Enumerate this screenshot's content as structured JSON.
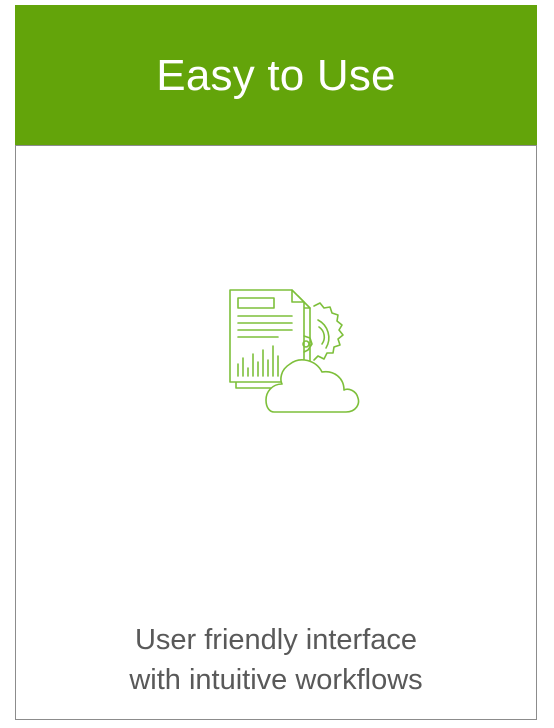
{
  "card": {
    "title": "Easy to Use",
    "description_lines": [
      "User friendly interface",
      "with intuitive workflows"
    ],
    "icon": "document-chart-gear-cloud-icon"
  },
  "colors": {
    "header_background": "#63a40a",
    "header_text": "#ffffff",
    "icon_stroke": "#7dbf3a",
    "body_text": "#595959",
    "card_border": "#8c8c8c"
  }
}
